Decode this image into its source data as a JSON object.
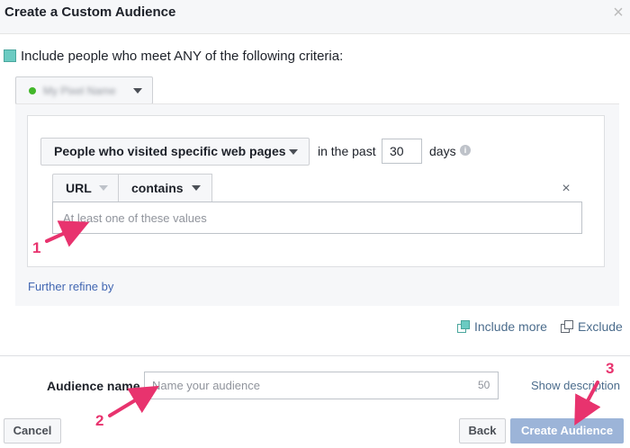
{
  "header": {
    "title": "Create a Custom Audience",
    "close_icon": "×"
  },
  "criteria": {
    "text": "Include people who meet ANY of the following criteria:"
  },
  "source_dropdown": {
    "value": "My Pixel Name"
  },
  "rule": {
    "type_value": "People who visited specific web pages",
    "in_the_past": "in the past",
    "days_value": "30",
    "days_label": "days",
    "info_icon": "i"
  },
  "filter": {
    "field_value": "URL",
    "operator_value": "contains",
    "remove_icon": "×",
    "values_placeholder": "At least one of these values"
  },
  "further_refine": "Further refine by",
  "actions": {
    "include_more": "Include more",
    "exclude": "Exclude"
  },
  "audience": {
    "label": "Audience name",
    "placeholder": "Name your audience",
    "char_limit": "50",
    "show_description": "Show description"
  },
  "buttons": {
    "cancel": "Cancel",
    "back": "Back",
    "create": "Create Audience"
  },
  "annotations": {
    "one": "1",
    "two": "2",
    "three": "3"
  },
  "colors": {
    "accent_teal": "#6bcbc2",
    "link": "#4267b2",
    "primary_disabled": "#9cb4d8",
    "annotation": "#e8336e"
  }
}
